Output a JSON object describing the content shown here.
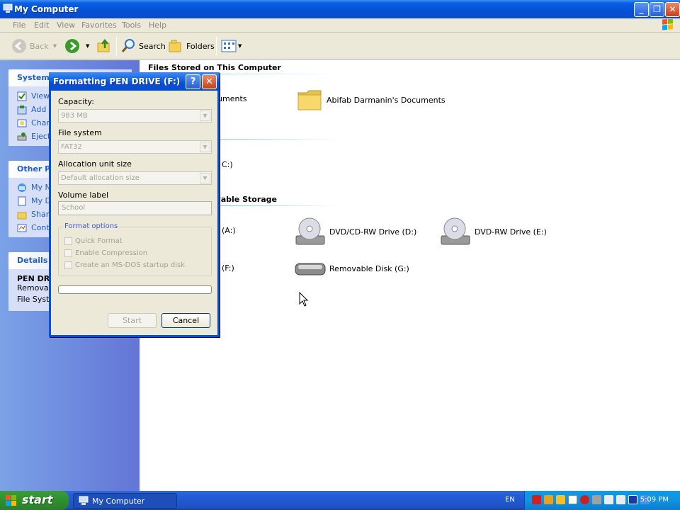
{
  "window": {
    "title": "My Computer"
  },
  "menu": [
    "File",
    "Edit",
    "View",
    "Favorites",
    "Tools",
    "Help"
  ],
  "toolbar": {
    "back": "Back",
    "search": "Search",
    "folders": "Folders"
  },
  "left_pane": {
    "system_tasks": {
      "title": "System T",
      "links": [
        "View",
        "Add o",
        "Chan",
        "Eject"
      ]
    },
    "other_places": {
      "title": "Other Pla",
      "links": [
        "My Ne",
        "My Do",
        "Share",
        "Contr"
      ]
    },
    "details": {
      "title": "Details",
      "name": "PEN DRIV",
      "type": "Removabl",
      "fs": "File Syster"
    }
  },
  "content": {
    "group_files": "Files Stored on This Computer",
    "shared_docs_partial": "cuments",
    "user_docs": "Abifab Darmanin's Documents",
    "hdd_partial": "C:)",
    "group_removable_partial": "ovable Storage",
    "floppy_partial": "(A:)",
    "dvd_cd_rw": "DVD/CD-RW Drive (D:)",
    "dvd_rw": "DVD-RW Drive (E:)",
    "pen_partial": "(F:)",
    "removable_g": "Removable Disk (G:)"
  },
  "dialog": {
    "title": "Formatting PEN DRIVE (F:)",
    "help": "?",
    "capacity_label": "Capacity:",
    "capacity_value": "983 MB",
    "fs_label": "File system",
    "fs_value": "FAT32",
    "alloc_label": "Allocation unit size",
    "alloc_value": "Default allocation size",
    "volume_label": "Volume label",
    "volume_value": "School",
    "options_legend": "Format options",
    "opt_quick": "Quick Format",
    "opt_compress": "Enable Compression",
    "opt_msdos": "Create an MS-DOS startup disk",
    "progress": 0,
    "start": "Start",
    "cancel": "Cancel"
  },
  "taskbar": {
    "start": "start",
    "task": "My Computer",
    "lang": "EN",
    "clock": "5:09 PM"
  },
  "colors": {
    "xp_blue": "#0550d8",
    "start_green": "#2f8f2f",
    "tray_blue": "#1292e1"
  }
}
